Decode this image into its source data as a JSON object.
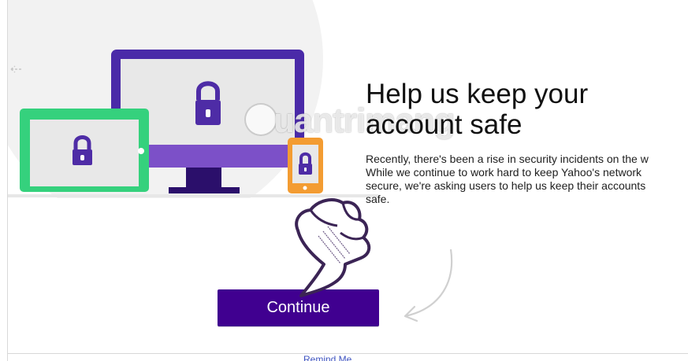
{
  "heading": {
    "text": "Help us keep your account safe"
  },
  "description": {
    "lines": [
      "Recently, there's been a rise in security incidents on the w",
      "While we continue to work hard to keep Yahoo's network",
      "secure, we're asking users to help us keep their accounts",
      "safe."
    ]
  },
  "actions": {
    "continue_label": "Continue"
  },
  "footer": {
    "link_text": "Remind Me"
  },
  "watermark": {
    "text": "uantrimang"
  },
  "colors": {
    "primary_button": "#400090",
    "laptop": "#4a2aa8",
    "tablet": "#35d17d",
    "phone": "#f39c32",
    "lock": "#4e2ca6"
  },
  "icons": {
    "devices": "secure-devices-illustration",
    "lock": "lock-icon",
    "hand": "pointing-hand-icon",
    "arrow": "curved-arrow-icon"
  }
}
